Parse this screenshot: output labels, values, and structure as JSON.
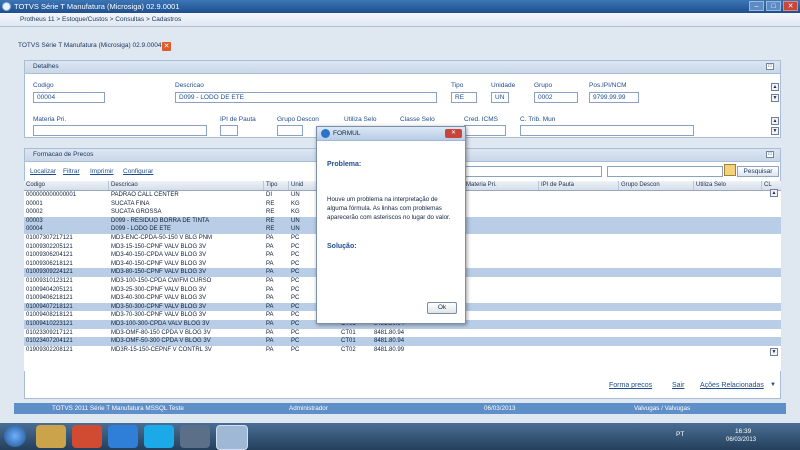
{
  "window": {
    "title": "TOTVS Série T Manufatura (Microsiga) 02.9.0001",
    "min": "–",
    "max": "□",
    "close": "✕"
  },
  "breadcrumb": "Protheus 11 > Estoque/Custos > Consultas > Cadastros",
  "tab": {
    "label": "TOTVS Série T Manufatura (Microsiga) 02.9.0004",
    "close": "✕"
  },
  "detalhes": {
    "title": "Detalhes",
    "fields": {
      "codigo": {
        "label": "Codigo",
        "value": "00004"
      },
      "descricao": {
        "label": "Descricao",
        "value": "D099 - LODO DE ETE"
      },
      "tipo": {
        "label": "Tipo",
        "value": "RE"
      },
      "unidade": {
        "label": "Unidade",
        "value": "UN"
      },
      "grupo": {
        "label": "Grupo",
        "value": "0002"
      },
      "pos_ipi": {
        "label": "Pos.IPI/NCM",
        "value": "9799.99.99"
      }
    },
    "row2_labels": {
      "materia": "Materia Pri.",
      "ipi": "IPI de Pauta",
      "grupo_desc": "Grupo Descon",
      "util_selo": "Utiliza Selo",
      "classe_selo": "Classe Selo",
      "cred_icms": "Cred. ICMS",
      "ctrib": "C. Trib. Mun"
    }
  },
  "formacao": {
    "title": "Formacao de Precos",
    "actions": {
      "localizar": "Localizar",
      "filtrar": "Filtrar",
      "imprimir": "Imprimir",
      "configurar": "Configurar"
    },
    "search_prefix": "o",
    "search_button": "Pesquisar",
    "columns": [
      "Codigo",
      "Descricao",
      "Tipo",
      "Unid",
      "Materia Pri.",
      "IPI de Pauta",
      "Grupo Descon",
      "Utiliza Selo",
      "CL"
    ],
    "rows": [
      [
        "000000000000001",
        "PADRAO CALL CENTER",
        "DI",
        "UN",
        "",
        ""
      ],
      [
        "00001",
        "SUCATA FINA",
        "RE",
        "KG",
        "",
        ""
      ],
      [
        "00002",
        "SUCATA GROSSA",
        "RE",
        "KG",
        "",
        ""
      ],
      [
        "00003",
        "D099 - RESIDUO BORRA DE TINTA",
        "RE",
        "UN",
        "",
        ""
      ],
      [
        "00004",
        "D099 - LODO DE ETE",
        "RE",
        "UN",
        "",
        ""
      ],
      [
        "01007307217121",
        "MD3-ENC-CPDA-50-150 V BLG PNM",
        "PA",
        "PC",
        "",
        ""
      ],
      [
        "01009302205121",
        "MD3-15-150-CPNF VALV BLOG 3V",
        "PA",
        "PC",
        "",
        ""
      ],
      [
        "01009306204121",
        "MD3-40-150-CPDA VALV BLOG 3V",
        "PA",
        "PC",
        "",
        ""
      ],
      [
        "01009306218121",
        "MD3-40-150-CPNF VALV BLOG 3V",
        "PA",
        "PC",
        "",
        ""
      ],
      [
        "01009309224121",
        "MD3-80-150-CPNF VALV BLOG 3V",
        "PA",
        "PC",
        "",
        ""
      ],
      [
        "01009310123121",
        "MD3-100-150-CPDA CW/FM CURSO",
        "PA",
        "PC",
        "",
        ""
      ],
      [
        "01009404205121",
        "MD3-25-300-CPNF VALV BLOG 3V",
        "PA",
        "PC",
        "",
        ""
      ],
      [
        "01009406218121",
        "MD3-40-300-CPNF VALV BLOG 3V",
        "PA",
        "PC",
        "",
        ""
      ],
      [
        "01009407218121",
        "MD3-50-300-CPNF VALV BLOG 3V",
        "PA",
        "PC",
        "",
        ""
      ],
      [
        "01009408218121",
        "MD3-70-300-CPNF VALV BLOG 3V",
        "PA",
        "PC",
        "",
        ""
      ],
      [
        "01009410223121",
        "MD3-100-300-CPDA VALV BLOG 3V",
        "PA",
        "PC",
        "CT01",
        "8481.80.94"
      ],
      [
        "01023309217121",
        "MD3-OMF-80-150 CPDA V BLOG 3V",
        "PA",
        "PC",
        "CT01",
        "8481.80.94"
      ],
      [
        "01023407204121",
        "MD3-OMF-50-300 CPDA V BLOG 3V",
        "PA",
        "PC",
        "CT01",
        "8481.80.94"
      ],
      [
        "01909302208121",
        "MD3R-15-150-CEPNF V CONTRL 3V",
        "PA",
        "PC",
        "CT02",
        "8481.80.99"
      ]
    ]
  },
  "dialog": {
    "title": "FORMUL",
    "close": "✕",
    "problema_label": "Problema:",
    "problema_text": "Houve um problema na interpretação de alguma fórmula. As linhas com problemas aparecerão com asteriscos no lugar do valor.",
    "solucao_label": "Solução:",
    "ok": "Ok"
  },
  "bottom_links": {
    "forma_precos": "Forma precos",
    "sair": "Sair",
    "acoes": "Ações Relacionadas"
  },
  "statusbar": {
    "env": "TOTVS 2011 Série T Manufatura MSSQL Teste",
    "user": "Administrador",
    "date": "06/03/2013",
    "company": "Valvugas / Valvugas"
  },
  "taskbar": {
    "lang": "PT",
    "time": "16:39",
    "date": "06/03/2013"
  },
  "colors": {
    "accent": "#1f4c8c",
    "row_alt": "#b9cde6",
    "status": "#5f8fc8"
  }
}
